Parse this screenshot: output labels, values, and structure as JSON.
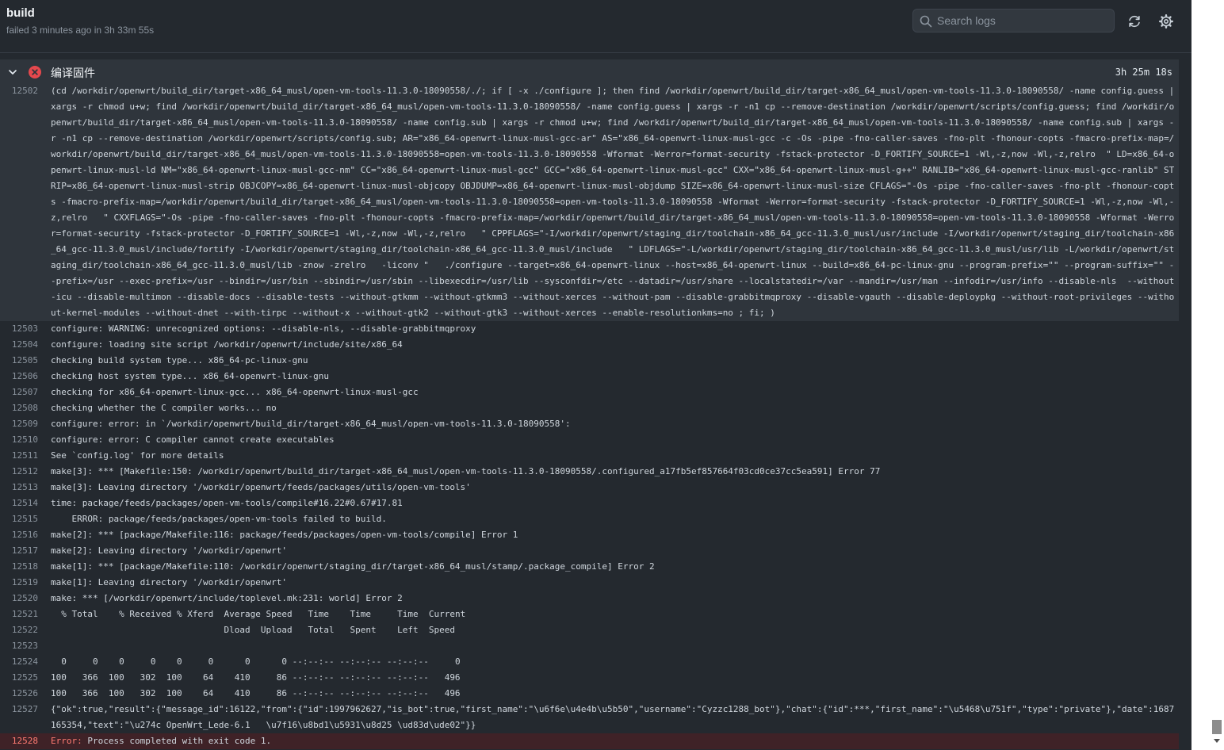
{
  "header": {
    "title": "build",
    "subtitle": "failed 3 minutes ago in 3h 33m 55s",
    "search_placeholder": "Search logs"
  },
  "step": {
    "name": "编译固件",
    "duration": "3h 25m 18s"
  },
  "colors": {
    "background": "#24292f",
    "error": "#e5484d",
    "error_row": "#3f2227"
  },
  "icons": [
    "search-icon",
    "refresh-icon",
    "gear-icon",
    "chevron-down-icon",
    "error-circle-icon"
  ],
  "log": {
    "lines": [
      {
        "n": "12502",
        "text": "(cd /workdir/openwrt/build_dir/target-x86_64_musl/open-vm-tools-11.3.0-18090558/./; if [ -x ./configure ]; then find /workdir/openwrt/build_dir/target-x86_64_musl/open-vm-tools-11.3.0-18090558/ -name config.guess | xargs -r chmod u+w; find /workdir/openwrt/build_dir/target-x86_64_musl/open-vm-tools-11.3.0-18090558/ -name config.guess | xargs -r -n1 cp --remove-destination /workdir/openwrt/scripts/config.guess; find /workdir/openwrt/build_dir/target-x86_64_musl/open-vm-tools-11.3.0-18090558/ -name config.sub | xargs -r chmod u+w; find /workdir/openwrt/build_dir/target-x86_64_musl/open-vm-tools-11.3.0-18090558/ -name config.sub | xargs -r -n1 cp --remove-destination /workdir/openwrt/scripts/config.sub; AR=\"x86_64-openwrt-linux-musl-gcc-ar\" AS=\"x86_64-openwrt-linux-musl-gcc -c -Os -pipe -fno-caller-saves -fno-plt -fhonour-copts -fmacro-prefix-map=/workdir/openwrt/build_dir/target-x86_64_musl/open-vm-tools-11.3.0-18090558=open-vm-tools-11.3.0-18090558 -Wformat -Werror=format-security -fstack-protector -D_FORTIFY_SOURCE=1 -Wl,-z,now -Wl,-z,relro  \" LD=x86_64-openwrt-linux-musl-ld NM=\"x86_64-openwrt-linux-musl-gcc-nm\" CC=\"x86_64-openwrt-linux-musl-gcc\" GCC=\"x86_64-openwrt-linux-musl-gcc\" CXX=\"x86_64-openwrt-linux-musl-g++\" RANLIB=\"x86_64-openwrt-linux-musl-gcc-ranlib\" STRIP=x86_64-openwrt-linux-musl-strip OBJCOPY=x86_64-openwrt-linux-musl-objcopy OBJDUMP=x86_64-openwrt-linux-musl-objdump SIZE=x86_64-openwrt-linux-musl-size CFLAGS=\"-Os -pipe -fno-caller-saves -fno-plt -fhonour-copts -fmacro-prefix-map=/workdir/openwrt/build_dir/target-x86_64_musl/open-vm-tools-11.3.0-18090558=open-vm-tools-11.3.0-18090558 -Wformat -Werror=format-security -fstack-protector -D_FORTIFY_SOURCE=1 -Wl,-z,now -Wl,-z,relro   \" CXXFLAGS=\"-Os -pipe -fno-caller-saves -fno-plt -fhonour-copts -fmacro-prefix-map=/workdir/openwrt/build_dir/target-x86_64_musl/open-vm-tools-11.3.0-18090558=open-vm-tools-11.3.0-18090558 -Wformat -Werror=format-security -fstack-protector -D_FORTIFY_SOURCE=1 -Wl,-z,now -Wl,-z,relro   \" CPPFLAGS=\"-I/workdir/openwrt/staging_dir/toolchain-x86_64_gcc-11.3.0_musl/usr/include -I/workdir/openwrt/staging_dir/toolchain-x86_64_gcc-11.3.0_musl/include/fortify -I/workdir/openwrt/staging_dir/toolchain-x86_64_gcc-11.3.0_musl/include   \" LDFLAGS=\"-L/workdir/openwrt/staging_dir/toolchain-x86_64_gcc-11.3.0_musl/usr/lib -L/workdir/openwrt/staging_dir/toolchain-x86_64_gcc-11.3.0_musl/lib -znow -zrelro   -liconv \"   ./configure --target=x86_64-openwrt-linux --host=x86_64-openwrt-linux --build=x86_64-pc-linux-gnu --program-prefix=\"\" --program-suffix=\"\" --prefix=/usr --exec-prefix=/usr --bindir=/usr/bin --sbindir=/usr/sbin --libexecdir=/usr/lib --sysconfdir=/etc --datadir=/usr/share --localstatedir=/var --mandir=/usr/man --infodir=/usr/info --disable-nls  --without-icu --disable-multimon --disable-docs --disable-tests --without-gtkmm --without-gtkmm3 --without-xerces --without-pam --disable-grabbitmqproxy --disable-vgauth --disable-deploypkg --without-root-privileges --without-kernel-modules --without-dnet --with-tirpc --without-x --without-gtk2 --without-gtk3 --without-xerces --enable-resolutionkms=no ; fi; )",
        "style": "hl"
      },
      {
        "n": "12503",
        "text": "configure: WARNING: unrecognized options: --disable-nls, --disable-grabbitmqproxy"
      },
      {
        "n": "12504",
        "text": "configure: loading site script /workdir/openwrt/include/site/x86_64"
      },
      {
        "n": "12505",
        "text": "checking build system type... x86_64-pc-linux-gnu"
      },
      {
        "n": "12506",
        "text": "checking host system type... x86_64-openwrt-linux-gnu"
      },
      {
        "n": "12507",
        "text": "checking for x86_64-openwrt-linux-gcc... x86_64-openwrt-linux-musl-gcc"
      },
      {
        "n": "12508",
        "text": "checking whether the C compiler works... no"
      },
      {
        "n": "12509",
        "text": "configure: error: in `/workdir/openwrt/build_dir/target-x86_64_musl/open-vm-tools-11.3.0-18090558':"
      },
      {
        "n": "12510",
        "text": "configure: error: C compiler cannot create executables"
      },
      {
        "n": "12511",
        "text": "See `config.log' for more details"
      },
      {
        "n": "12512",
        "text": "make[3]: *** [Makefile:150: /workdir/openwrt/build_dir/target-x86_64_musl/open-vm-tools-11.3.0-18090558/.configured_a17fb5ef857664f03cd0ce37cc5ea591] Error 77"
      },
      {
        "n": "12513",
        "text": "make[3]: Leaving directory '/workdir/openwrt/feeds/packages/utils/open-vm-tools'"
      },
      {
        "n": "12514",
        "text": "time: package/feeds/packages/open-vm-tools/compile#16.22#0.67#17.81"
      },
      {
        "n": "12515",
        "text": "    ERROR: package/feeds/packages/open-vm-tools failed to build."
      },
      {
        "n": "12516",
        "text": "make[2]: *** [package/Makefile:116: package/feeds/packages/open-vm-tools/compile] Error 1"
      },
      {
        "n": "12517",
        "text": "make[2]: Leaving directory '/workdir/openwrt'"
      },
      {
        "n": "12518",
        "text": "make[1]: *** [package/Makefile:110: /workdir/openwrt/staging_dir/target-x86_64_musl/stamp/.package_compile] Error 2"
      },
      {
        "n": "12519",
        "text": "make[1]: Leaving directory '/workdir/openwrt'"
      },
      {
        "n": "12520",
        "text": "make: *** [/workdir/openwrt/include/toplevel.mk:231: world] Error 2"
      },
      {
        "n": "12521",
        "text": "  % Total    % Received % Xferd  Average Speed   Time    Time     Time  Current"
      },
      {
        "n": "12522",
        "text": "                                 Dload  Upload   Total   Spent    Left  Speed"
      },
      {
        "n": "12523",
        "text": ""
      },
      {
        "n": "12524",
        "text": "  0     0    0     0    0     0      0      0 --:--:-- --:--:-- --:--:--     0"
      },
      {
        "n": "12525",
        "text": "100   366  100   302  100    64    410     86 --:--:-- --:--:-- --:--:--   496"
      },
      {
        "n": "12526",
        "text": "100   366  100   302  100    64    410     86 --:--:-- --:--:-- --:--:--   496"
      },
      {
        "n": "12527",
        "text": "{\"ok\":true,\"result\":{\"message_id\":16122,\"from\":{\"id\":1997962627,\"is_bot\":true,\"first_name\":\"\\u6f6e\\u4e4b\\u5b50\",\"username\":\"Cyzzc1288_bot\"},\"chat\":{\"id\":***,\"first_name\":\"\\u5468\\u751f\",\"type\":\"private\"},\"date\":1687165354,\"text\":\"\\u274c OpenWrt_Lede-6.1   \\u7f16\\u8bd1\\u5931\\u8d25 \\ud83d\\ude02\"}}"
      },
      {
        "n": "12528",
        "label": "Error:",
        "text": " Process completed with exit code 1.",
        "style": "err"
      }
    ]
  }
}
